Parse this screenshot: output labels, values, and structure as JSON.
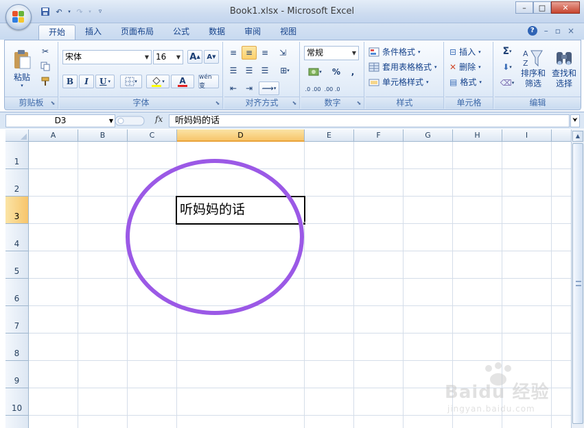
{
  "window": {
    "title": "Book1.xlsx - Microsoft Excel",
    "min": "–",
    "max": "□",
    "close": "✕"
  },
  "qat": {
    "save_icon": "save-icon",
    "undo_icon": "undo-icon",
    "redo_icon": "redo-icon",
    "customize_icon": "customize-icon"
  },
  "tabs": [
    "开始",
    "插入",
    "页面布局",
    "公式",
    "数据",
    "审阅",
    "视图"
  ],
  "active_tab": "开始",
  "tab_right": {
    "help": "?",
    "min": "–",
    "restore": "▫",
    "close": "×"
  },
  "ribbon": {
    "clipboard": {
      "paste": "粘贴",
      "label": "剪贴板"
    },
    "font": {
      "name": "宋体",
      "size": "16",
      "grow": "A",
      "shrink": "A",
      "bold": "B",
      "italic": "I",
      "underline": "U",
      "font_color_glyph": "A",
      "phonetic": "wén 变",
      "label": "字体"
    },
    "alignment": {
      "label": "对齐方式"
    },
    "number": {
      "format": "常规",
      "percent": "%",
      "comma": ",",
      "inc": ".0 .00",
      "dec": ".00 .0",
      "label": "数字"
    },
    "styles": {
      "conditional": "条件格式",
      "table": "套用表格格式",
      "cell": "单元格样式",
      "label": "样式"
    },
    "cells": {
      "insert": "插入",
      "delete": "删除",
      "format": "格式",
      "label": "单元格"
    },
    "editing": {
      "sum": "Σ",
      "sort": "排序和\n筛选",
      "find": "查找和\n选择",
      "label": "编辑"
    }
  },
  "formula_bar": {
    "name_box": "D3",
    "fx": "fx",
    "content": "听妈妈的话"
  },
  "grid": {
    "columns": [
      "A",
      "B",
      "C",
      "D",
      "E",
      "F",
      "G",
      "H",
      "I"
    ],
    "rows": [
      "1",
      "2",
      "3",
      "4",
      "5",
      "6",
      "7",
      "8",
      "9",
      "10"
    ],
    "active_cell": "D3",
    "active_value": "听妈妈的话"
  },
  "annotation": {
    "shape": "ellipse",
    "color": "#9b59e6"
  },
  "watermark": {
    "brand": "Baidu 经验",
    "url": "jingyan.baidu.com"
  }
}
